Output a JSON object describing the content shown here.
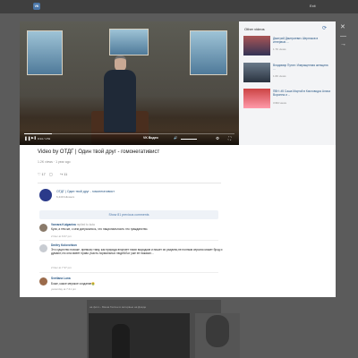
{
  "topbar": {
    "logo": "VK",
    "exit": "Exit"
  },
  "sidebar_icons": {
    "close": "✕",
    "collapse": "—",
    "pin": "→"
  },
  "background_page": {
    "caption": "на фото - Маша Гессен в интервью на Дожде"
  },
  "player": {
    "time": "0:14 / 1:51",
    "progress": 0.13,
    "brand": "VK Видео",
    "controls": {
      "pause": "❚❚",
      "next": "▶❚",
      "volume": "🔊",
      "settings": "⚙",
      "fullscreen": "⛶"
    }
  },
  "video": {
    "title": "Video by ОТДГ | Один твой друг - гомонегативист",
    "views": "1.2K views",
    "age": "1 year ago",
    "likes": "17",
    "reposts": "11"
  },
  "channel": {
    "name": "ОТДГ | Один твой друг - гомонегативист",
    "subscribers": "6,449 followers"
  },
  "comments_toggle": "Show 81 previous comments",
  "comments": [
    {
      "name": "Varvara Kulganina",
      "reply": "replied to kuta",
      "text": "Кузя, а тем же, с кем допускалось, что национальность это гражданство.",
      "date": "2 Dec at 6:07 pm"
    },
    {
      "name": "Dmitry Kolovchkov",
      "reply": "",
      "text": "Это существо похоже ,премьер тиму, как природа вторгает таких выродков и пишет их разумно,не полным серьезо может брод и думают,что она имеет право участь нормальных людей.Бог уже ее наказал...",
      "date": "2 Dec at 7:37 pm"
    },
    {
      "name": "Svetlana Luna",
      "reply": "",
      "text": "Боже, какое мерзкое создание🤮",
      "date": "yesterday at 7:41 pm"
    }
  ],
  "other_videos": {
    "title": "Other videos",
    "refresh": "⟳",
    "items": [
      {
        "title": "Дмитрий Дмитриевич Шерняков в интервью ...",
        "views": "1.7K views"
      },
      {
        "title": "Владимир Путин: Извращенная женщина ...",
        "views": "1.6K views"
      },
      {
        "title": "ПВН: #5 Саша Мартой в Кисловодск Алиса Воронеж и ...",
        "views": "3.9M views"
      }
    ]
  },
  "colors": {
    "accent": "#4a76a8",
    "link": "#2a5885",
    "overlay": "#5b5b5b"
  }
}
